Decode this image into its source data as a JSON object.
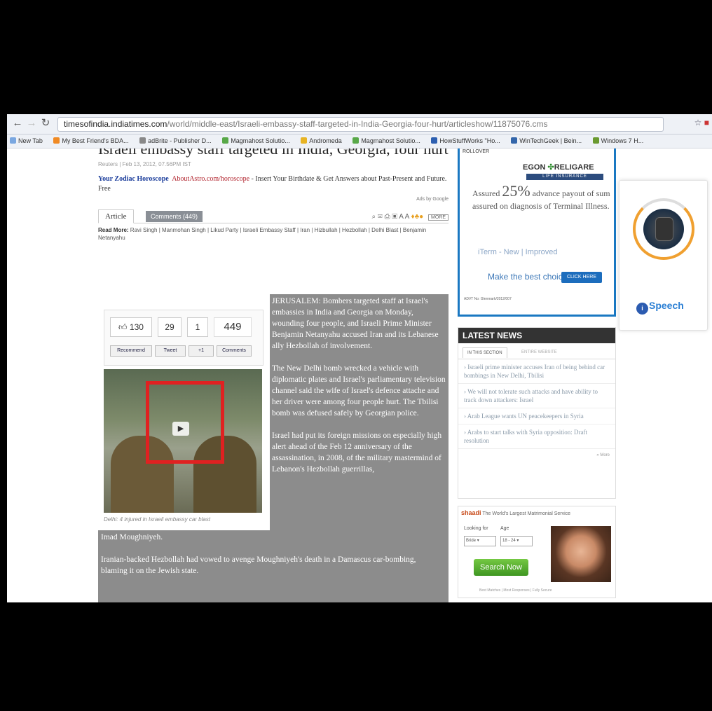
{
  "browser": {
    "url_host": "timesofindia.indiatimes.com",
    "url_path": "/world/middle-east/Israeli-embassy-staff-targeted-in-India-Georgia-four-hurt/articleshow/11875076.cms",
    "bookmarks": [
      "New Tab",
      "My Best Friend's BDA...",
      "adBrite - Publisher D...",
      "Magmahost Solutio...",
      "Andromeda",
      "Magmahost Solutio...",
      "HowStuffWorks \"Ho...",
      "WinTechGeek | Bein...",
      "Windows 7 H..."
    ]
  },
  "article": {
    "title": "Israeli embassy staff targeted in India, Georgia, four hurt",
    "byline": "Reuters | Feb 13, 2012, 07.56PM IST",
    "ad_link_title": "Your Zodiac Horoscope",
    "ad_link_url": "AboutAstro.com/horoscope",
    "ad_link_text": " - Insert Your Birthdate & Get Answers about Past-Present and Future. Free",
    "ads_by": "Ads by Google",
    "tab_article": "Article",
    "tab_comments": "Comments (449)",
    "tools_more": "MORE",
    "read_more_label": "Read More:",
    "read_more_links": "Ravi Singh | Manmohan Singh | Likud Party | Israeli Embassy Staff | Iran | Hizbullah | Hezbollah | Delhi Blast | Benjamin Netanyahu",
    "share": {
      "likes": "130",
      "tweets": "29",
      "plus": "1",
      "comments": "449",
      "recommend": "Recommend",
      "tweet": "Tweet",
      "plusone": "+1",
      "comments_btn": "Comments"
    },
    "caption": "Delhi: 4 injured in Israeli embassy car blast",
    "para1": "JERUSALEM: Bombers targeted staff at Israel's embassies in India and Georgia on Monday, wounding four people, and Israeli Prime Minister Benjamin Netanyahu accused Iran and its Lebanese ally Hezbollah of involvement.",
    "para2": "The New Delhi bomb wrecked a vehicle with diplomatic plates and Israel's parliamentary television channel said the wife of Israel's defence attache and her driver were among four people hurt. The Tbilisi bomb was defused safely by Georgian police.",
    "para3": "Israel had put its foreign missions on especially high alert ahead of the Feb 12 anniversary of the assassination, in 2008, of the military mastermind of Lebanon's Hezbollah guerrillas,",
    "para3b": "Imad Moughniyeh.",
    "para4": "Iranian-backed Hezbollah had vowed to avenge Moughniyeh's death in a Damascus car-bombing, blaming it on the Jewish state."
  },
  "sidebar": {
    "ad1": {
      "rollover": "ROLLOVER",
      "brand1": "EGON",
      "brand2": "RELIGARE",
      "lifebar": "LIFE INSURANCE",
      "assured_pre": "Assured ",
      "assured_pct": "25%",
      "assured_post": " advance payout of sum assured on diagnosis of Terminal Illness.",
      "iterm": "iTerm - New | Improved",
      "make": "Make the best choice",
      "click": "CLICK HERE",
      "footer": "ADVT No: Glenmark/2012/007"
    },
    "latest": {
      "heading": "LATEST NEWS",
      "tab1": "IN THIS SECTION",
      "tab2": "ENTIRE WEBSITE",
      "items": [
        "Israeli prime minister accuses Iran of being behind car bombings in New Delhi, Tbilisi",
        "We will not tolerate such attacks and have ability to track down attackers: Israel",
        "Arab League wants UN peacekeepers in Syria",
        "Arabs to start talks with Syria opposition: Draft resolution"
      ],
      "more": "» More"
    },
    "ad2": {
      "brand": "shaadi",
      "tagline": "The World's Largest Matrimonial Service",
      "looking_label": "Looking for",
      "age_label": "Age",
      "looking_value": "Bride",
      "age_value": "18 - 24",
      "search_btn": "Search Now",
      "footer": "Best Matches | Most Responses | Fully Secure"
    }
  },
  "extension": {
    "name": "Speech"
  }
}
